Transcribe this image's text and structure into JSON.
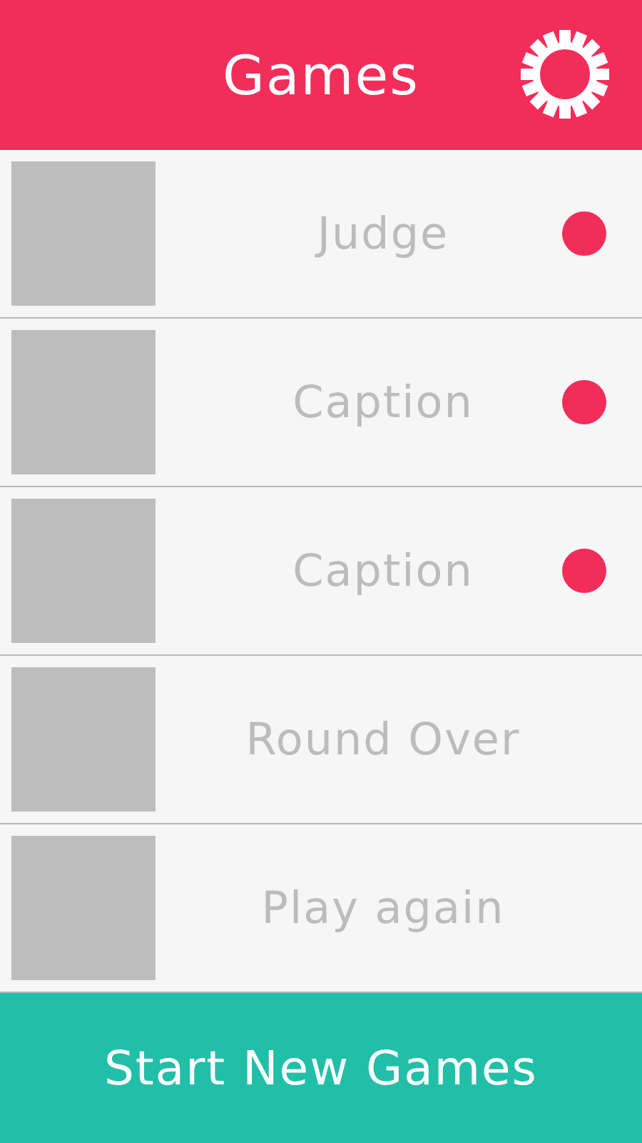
{
  "header": {
    "title": "Games"
  },
  "games": [
    {
      "label": "Judge",
      "unread": true
    },
    {
      "label": "Caption",
      "unread": true
    },
    {
      "label": "Caption",
      "unread": true
    },
    {
      "label": "Round Over",
      "unread": false
    },
    {
      "label": "Play again",
      "unread": false
    }
  ],
  "footer": {
    "button": "Start New Games"
  }
}
